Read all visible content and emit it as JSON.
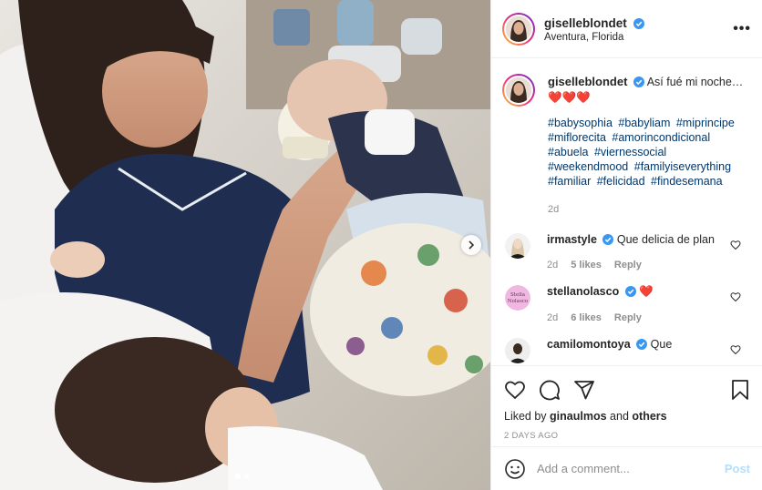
{
  "post": {
    "author": "giselleblondet",
    "location": "Aventura, Florida",
    "more_label": "•••",
    "caption_text": "Así fué mi noche…",
    "caption_emoji": "❤️❤️❤️",
    "hashtags": [
      "#babysophia",
      "#babyliam",
      "#miprincipe",
      "#miflorecita",
      "#amorincondicional",
      "#abuela",
      "#viernessocial",
      "#weekendmood",
      "#familyiseverything",
      "#familiar",
      "#felicidad",
      "#findesemana"
    ],
    "caption_age": "2d",
    "liked_by_prefix": "Liked by",
    "liked_by_user": "ginaulmos",
    "liked_by_and": "and",
    "liked_by_others": "others",
    "posted_ago": "2 DAYS AGO",
    "carousel": {
      "current": 1,
      "total": 2
    }
  },
  "comments": [
    {
      "user": "irmastyle",
      "text": "Que delicia de plan",
      "age": "2d",
      "likes": "5 likes",
      "reply": "Reply"
    },
    {
      "user": "stellanolasco",
      "text": "❤️",
      "age": "2d",
      "likes": "6 likes",
      "reply": "Reply",
      "avatar_text": "Stella Nolasco"
    },
    {
      "user": "camilomontoya",
      "text": "Que",
      "age": "",
      "likes": "",
      "reply": ""
    }
  ],
  "composer": {
    "placeholder": "Add a comment...",
    "post_label": "Post"
  },
  "colors": {
    "link": "#00376b",
    "verified": "#3897f0",
    "post_disabled": "#b2dffc",
    "heart": "#ed4956"
  },
  "icons": [
    "verified-badge-icon",
    "more-options-icon",
    "heart-icon",
    "comment-icon",
    "share-icon",
    "bookmark-icon",
    "emoji-icon",
    "chevron-right-icon"
  ]
}
